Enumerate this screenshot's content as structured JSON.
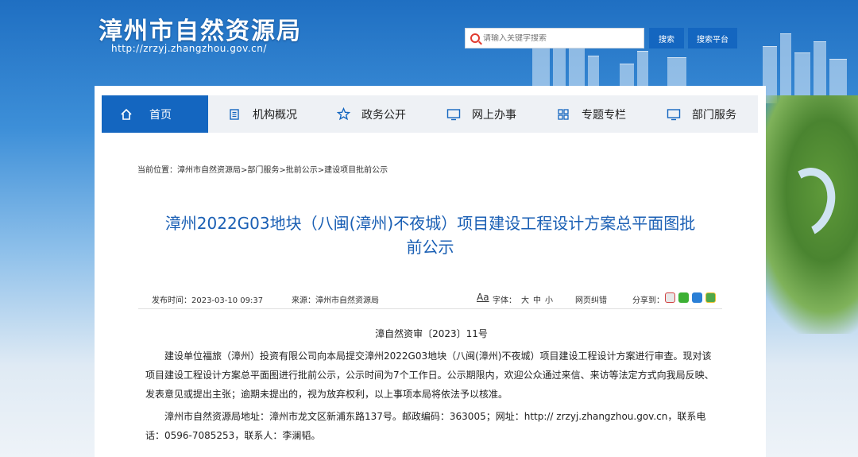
{
  "header": {
    "title": "漳州市自然资源局",
    "url": "http://zrzyj.zhangzhou.gov.cn/",
    "search_placeholder": "请输入关键字搜索",
    "search_label": "搜索",
    "platform_label": "搜索平台"
  },
  "nav": {
    "items": [
      {
        "label": "首页",
        "icon": "home-icon"
      },
      {
        "label": "机构概况",
        "icon": "document-list-icon"
      },
      {
        "label": "政务公开",
        "icon": "star-icon"
      },
      {
        "label": "网上办事",
        "icon": "monitor-icon"
      },
      {
        "label": "专题专栏",
        "icon": "grid-icon"
      },
      {
        "label": "部门服务",
        "icon": "monitor-icon"
      }
    ]
  },
  "breadcrumb": "当前位置：漳州市自然资源局>部门服务>批前公示>建设项目批前公示",
  "article": {
    "title_line1": "漳州2022G03地块（八闽(漳州)不夜城）项目建设工程设计方案总平面图批",
    "title_line2": "前公示",
    "publish_time": "发布时间：2023-03-10 09:37",
    "source": "来源：漳州市自然资源局",
    "font_icon_label": "Aa",
    "font_label": "字体：",
    "font_large": "大",
    "font_medium": "中",
    "font_small": "小",
    "correction": "网页纠错",
    "share_label": "分享到：",
    "doc_number": "漳自然资审〔2023〕11号",
    "paragraph1": "建设单位福旅（漳州）投资有限公司向本局提交漳州2022G03地块（八闽(漳州)不夜城）项目建设工程设计方案进行审查。现对该项目建设工程设计方案总平面图进行批前公示，公示时间为7个工作日。公示期限内，欢迎公众通过来信、来访等法定方式向我局反映、发表意见或提出主张；逾期未提出的，视为放弃权利，以上事项本局将依法予以核准。",
    "paragraph2": "漳州市自然资源局地址：漳州市龙文区新浦东路137号。邮政编码：363005；网址：http:// zrzyj.zhangzhou.gov.cn，联系电话：0596-7085253，联系人：李澜韬。"
  },
  "colors": {
    "primary": "#1466c0",
    "title": "#1a5fb4",
    "nav_bg": "#eef1f5"
  }
}
